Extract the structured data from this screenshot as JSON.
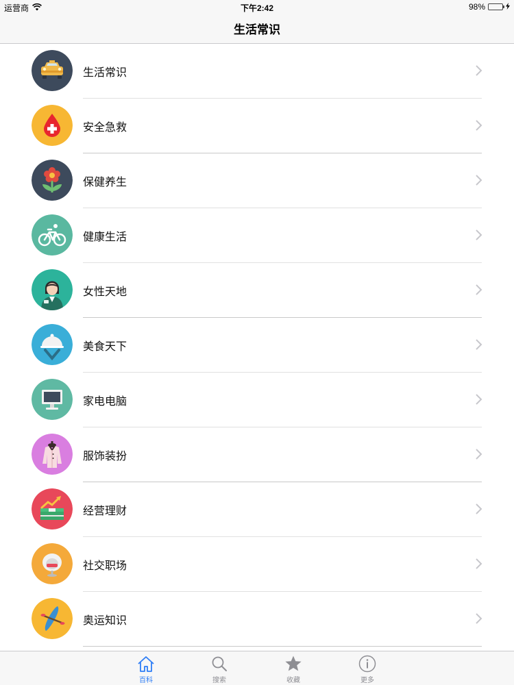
{
  "status_bar": {
    "carrier": "运营商",
    "time": "下午2:42",
    "battery": "98%",
    "battery_level": 0.98
  },
  "nav": {
    "title": "生活常识"
  },
  "list": [
    {
      "label": "生活常识",
      "icon": "taxi-icon",
      "color": "#3d4a5c"
    },
    {
      "label": "安全急救",
      "icon": "blood-drop-icon",
      "color": "#f7b733"
    },
    {
      "label": "保健养生",
      "icon": "flower-icon",
      "color": "#3d4a5c"
    },
    {
      "label": "健康生活",
      "icon": "bicycle-icon",
      "color": "#5ab8a0"
    },
    {
      "label": "女性天地",
      "icon": "woman-icon",
      "color": "#2cb39b"
    },
    {
      "label": "美食天下",
      "icon": "food-cloche-icon",
      "color": "#3aaed8"
    },
    {
      "label": "家电电脑",
      "icon": "monitor-icon",
      "color": "#5fb9a3"
    },
    {
      "label": "服饰装扮",
      "icon": "jacket-icon",
      "color": "#d97ee0"
    },
    {
      "label": "经营理财",
      "icon": "money-chart-icon",
      "color": "#e8485a"
    },
    {
      "label": "社交职场",
      "icon": "egg-chair-icon",
      "color": "#f4a93a"
    },
    {
      "label": "奥运知识",
      "icon": "canoe-icon",
      "color": "#f7b733"
    }
  ],
  "tabs": [
    {
      "label": "百科",
      "icon": "home-icon",
      "active": true
    },
    {
      "label": "搜索",
      "icon": "search-icon",
      "active": false
    },
    {
      "label": "收藏",
      "icon": "star-icon",
      "active": false
    },
    {
      "label": "更多",
      "icon": "info-icon",
      "active": false
    }
  ],
  "colors": {
    "accent": "#2d7df6",
    "tab_inactive": "#8e8e93",
    "chevron": "#c7c7cc"
  }
}
